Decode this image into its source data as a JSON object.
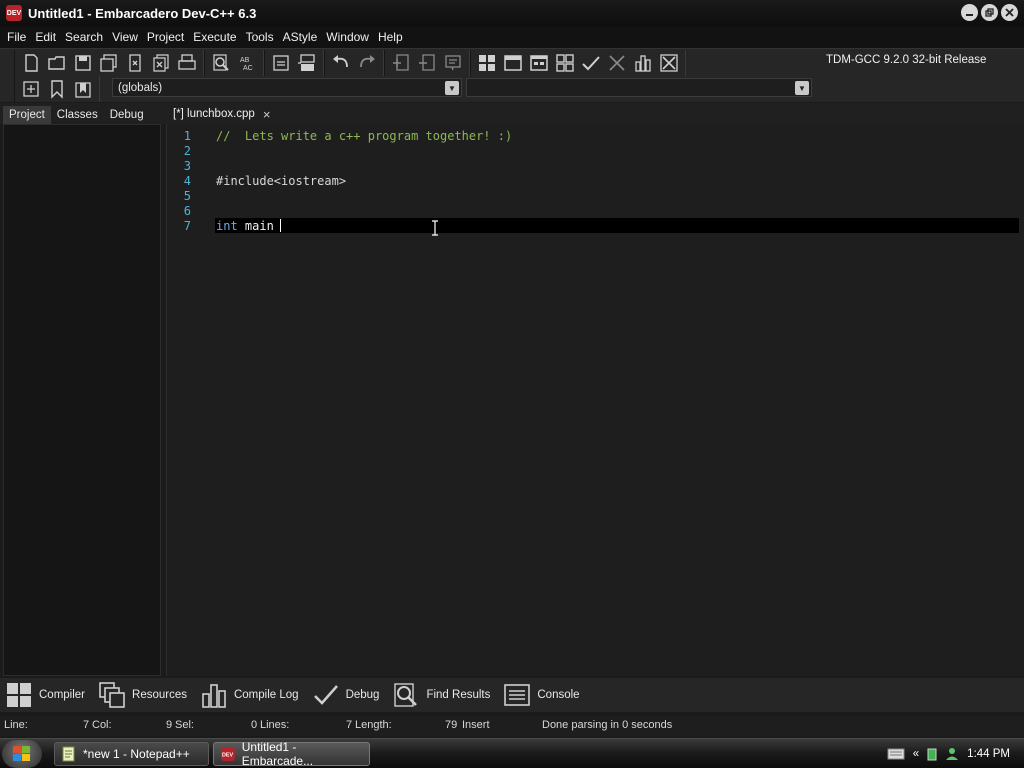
{
  "window": {
    "title": "Untitled1 - Embarcadero Dev-C++ 6.3",
    "icon_text": "DEV",
    "controls": [
      "minimize",
      "restore",
      "close"
    ]
  },
  "menu": [
    "File",
    "Edit",
    "Search",
    "View",
    "Project",
    "Execute",
    "Tools",
    "AStyle",
    "Window",
    "Help"
  ],
  "toolbar": {
    "compiler": "TDM-GCC 9.2.0 32-bit Release",
    "scope": "(globals)",
    "members": ""
  },
  "left_panel": {
    "tabs": [
      "Project",
      "Classes",
      "Debug"
    ],
    "active_tab": "Project"
  },
  "editor": {
    "tab": {
      "label": "[*] lunchbox.cpp",
      "close": "×"
    },
    "line_numbers": [
      "1",
      "2",
      "3",
      "4",
      "5",
      "6",
      "7"
    ],
    "lines": [
      {
        "text": "//  Lets write a c++ program together! :)"
      },
      {
        "text": ""
      },
      {
        "text": ""
      },
      {
        "text": "#include<iostream>"
      },
      {
        "text": ""
      },
      {
        "text": ""
      },
      {
        "keyword": "int",
        "ident": " main"
      }
    ]
  },
  "bottom_tabs": [
    "Compiler",
    "Resources",
    "Compile Log",
    "Debug",
    "Find Results",
    "Console"
  ],
  "status": {
    "line_label": "Line:",
    "line": "7",
    "col_label": "Col:",
    "col": "9",
    "sel_label": "Sel:",
    "sel": "0",
    "lines_label": "Lines:",
    "lines": "7",
    "length_label": "Length:",
    "length": "79",
    "mode": "Insert",
    "message": "Done parsing in 0 seconds"
  },
  "taskbar": {
    "tasks": [
      {
        "label": "*new 1 - Notepad++"
      },
      {
        "label": "Untitled1 - Embarcade..."
      }
    ],
    "overflow": "«",
    "clock": "1:44 PM"
  },
  "colors": {
    "comment": "#8fb84f",
    "keyword": "#6fa8e8",
    "line_number": "#4fb2d6",
    "current_line": "#000000"
  }
}
